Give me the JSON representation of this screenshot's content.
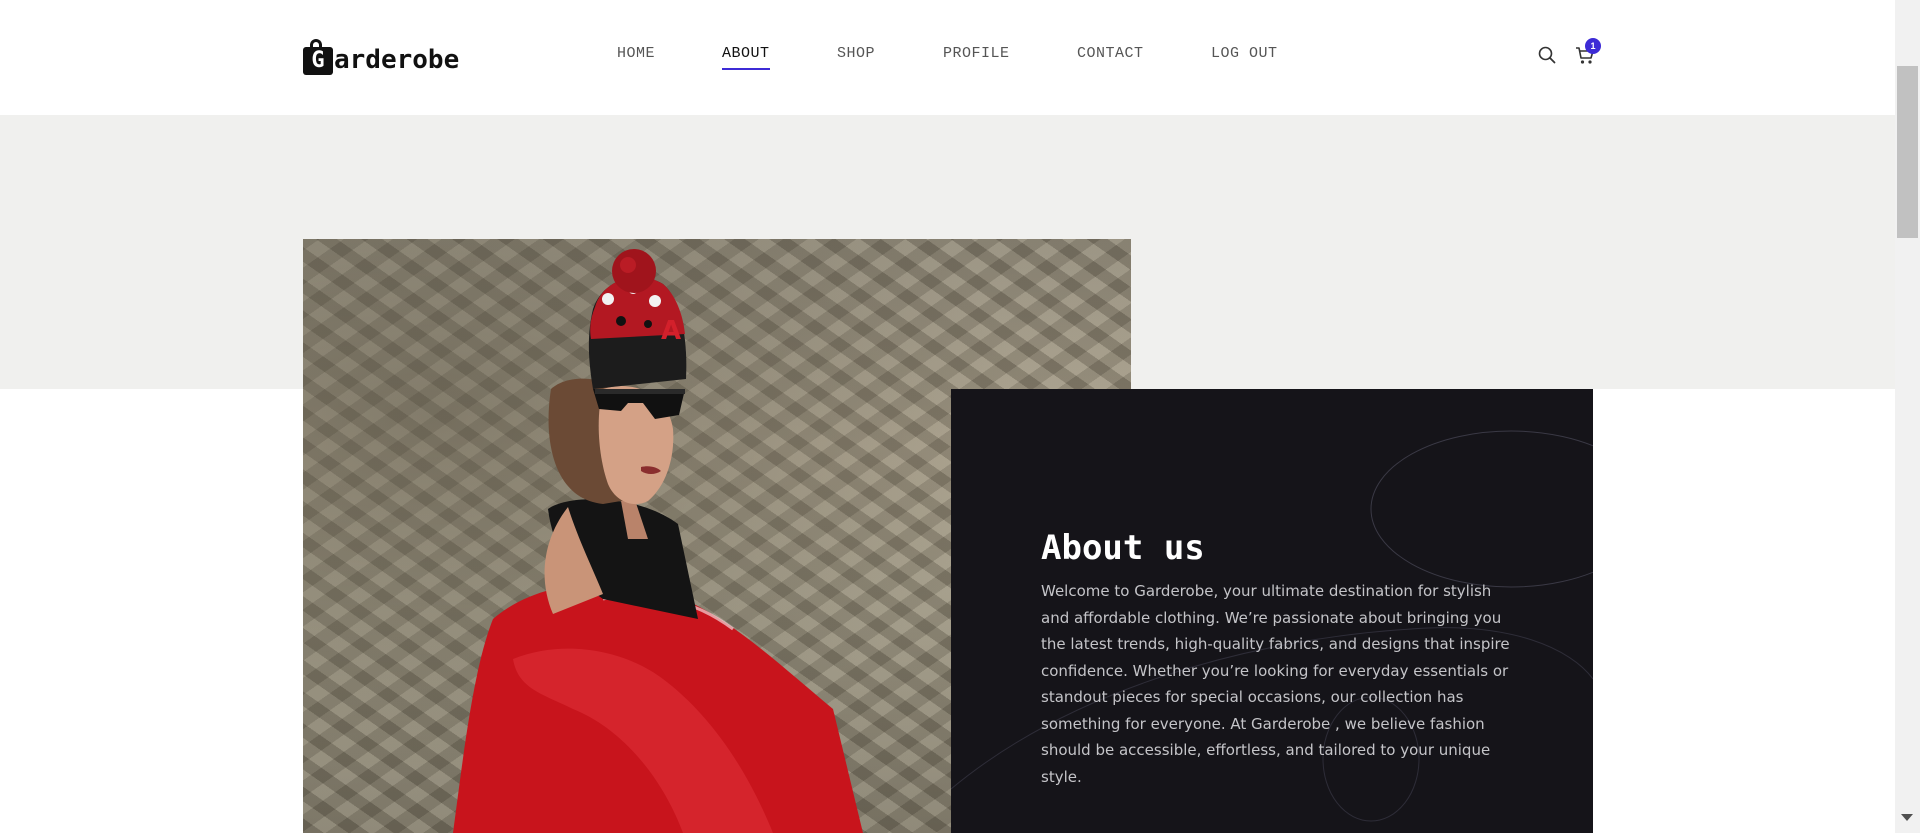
{
  "brand": {
    "logo_letter": "G",
    "name_rest": "arderobe"
  },
  "nav": {
    "items": [
      {
        "label": "HOME"
      },
      {
        "label": "ABOUT",
        "active": true
      },
      {
        "label": "SHOP"
      },
      {
        "label": "PROFILE"
      },
      {
        "label": "CONTACT"
      },
      {
        "label": "LOG OUT"
      }
    ]
  },
  "header_icons": {
    "search": "search-icon",
    "cart": "cart-icon",
    "cart_count": "1"
  },
  "about": {
    "title": "About us",
    "text": "Welcome to Garderobe, your ultimate destination for stylish and affordable clothing. We’re passionate about bringing you the latest trends, high-quality fabrics, and designs that inspire confidence. Whether you’re looking for everyday essentials or standout pieces for special occasions, our collection has something for everyone. At Garderobe , we believe fashion should be accessible, effortless, and tailored to your unique style."
  },
  "colors": {
    "accent": "#3d2bd6",
    "band": "#f0f0ee",
    "card": "#151419",
    "jacket": "#c8141c"
  }
}
